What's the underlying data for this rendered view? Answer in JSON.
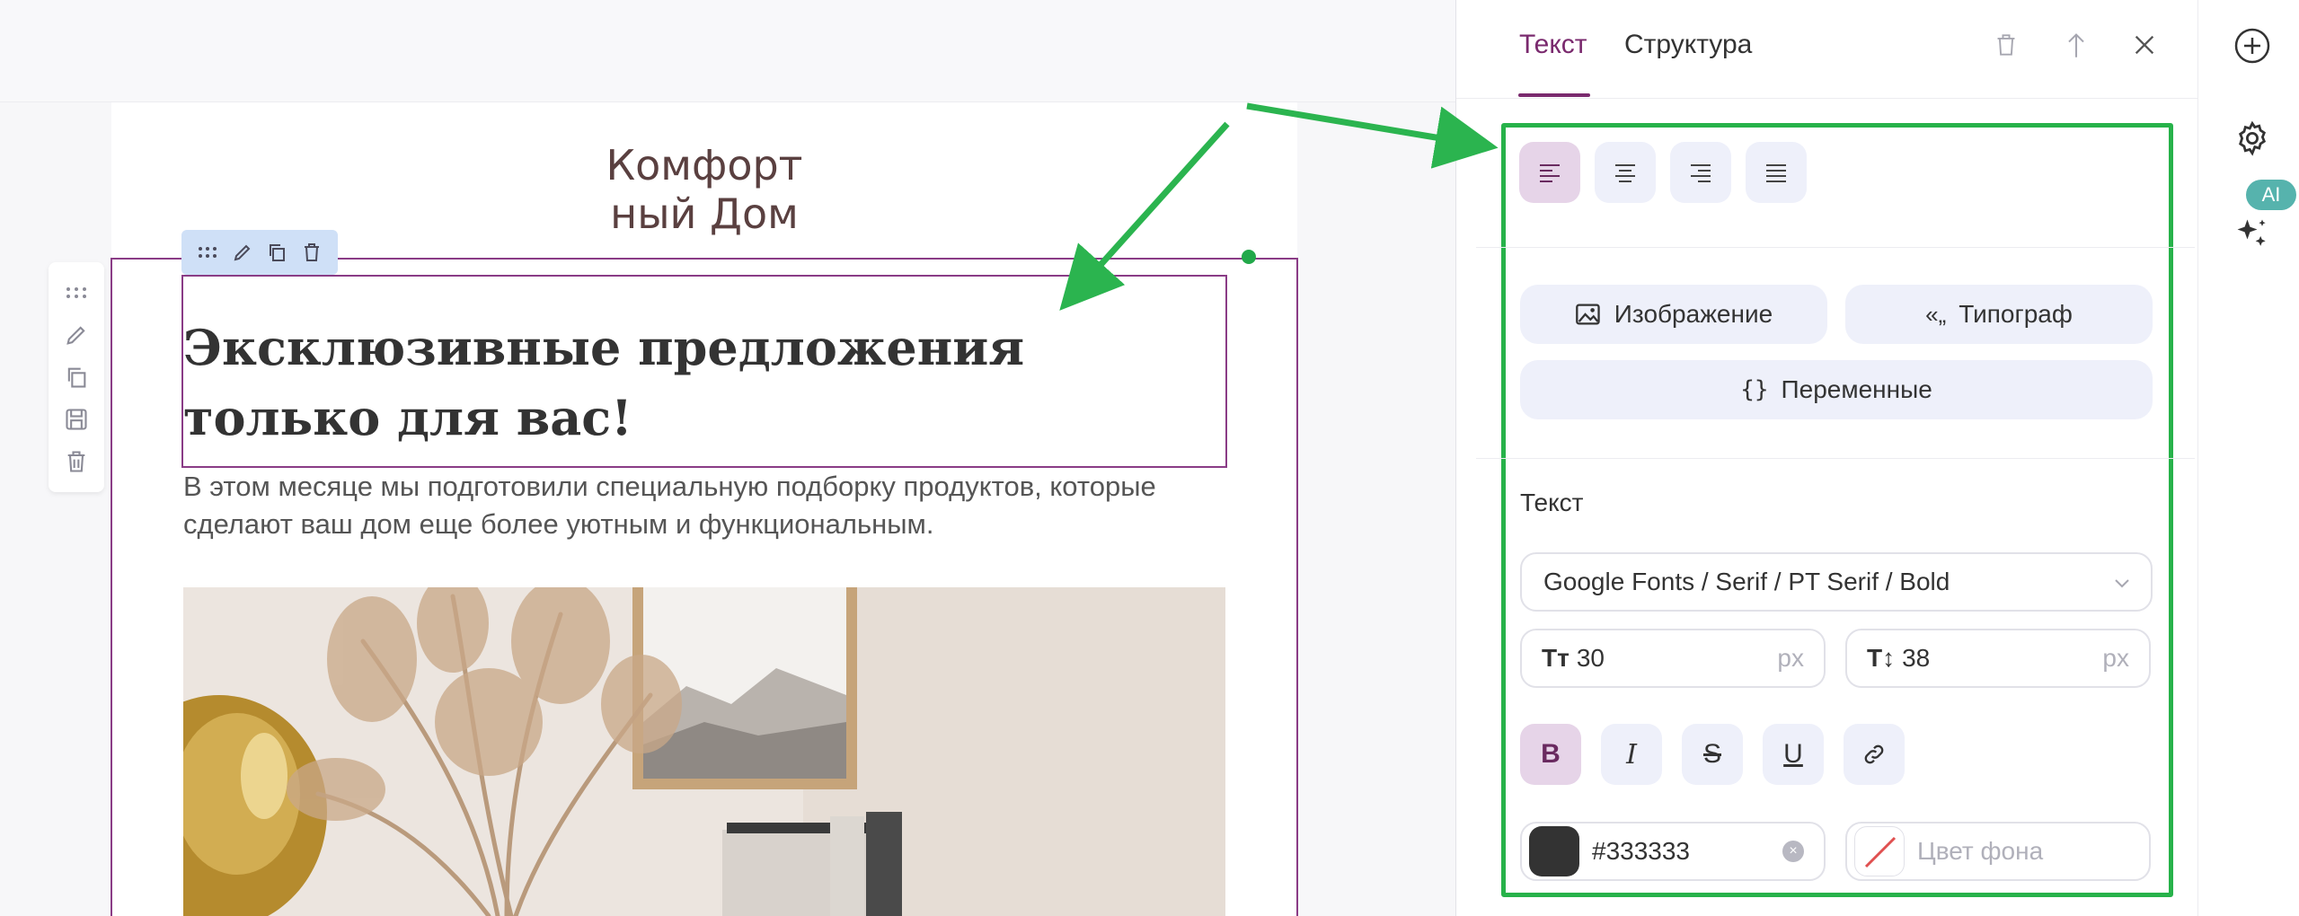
{
  "email": {
    "logo": "Комфорт ный Дом",
    "heading": "Эксклюзивные предложения только для вас!",
    "paragraph": "В этом месяце мы подготовили специальную подборку продуктов, которые сделают ваш дом еще более уютным и функциональным."
  },
  "panel": {
    "tabs": [
      {
        "label": "Текст",
        "active": true
      },
      {
        "label": "Структура",
        "active": false
      }
    ],
    "buttons": {
      "image": "Изображение",
      "typograph": "Типограф",
      "variables": "Переменные"
    },
    "text_section_label": "Текст",
    "font_select": "Google Fonts / Serif / PT Serif / Bold",
    "font_size": "30",
    "line_height": "38",
    "unit": "px",
    "text_color": "#333333",
    "bg_color_placeholder": "Цвет фона"
  },
  "rail": {
    "ai_badge": "AI"
  },
  "colors": {
    "accent": "#7a2a6e",
    "highlight_green": "#27b24a",
    "text_color_swatch": "#333333",
    "ai_badge": "#56b3ad"
  }
}
